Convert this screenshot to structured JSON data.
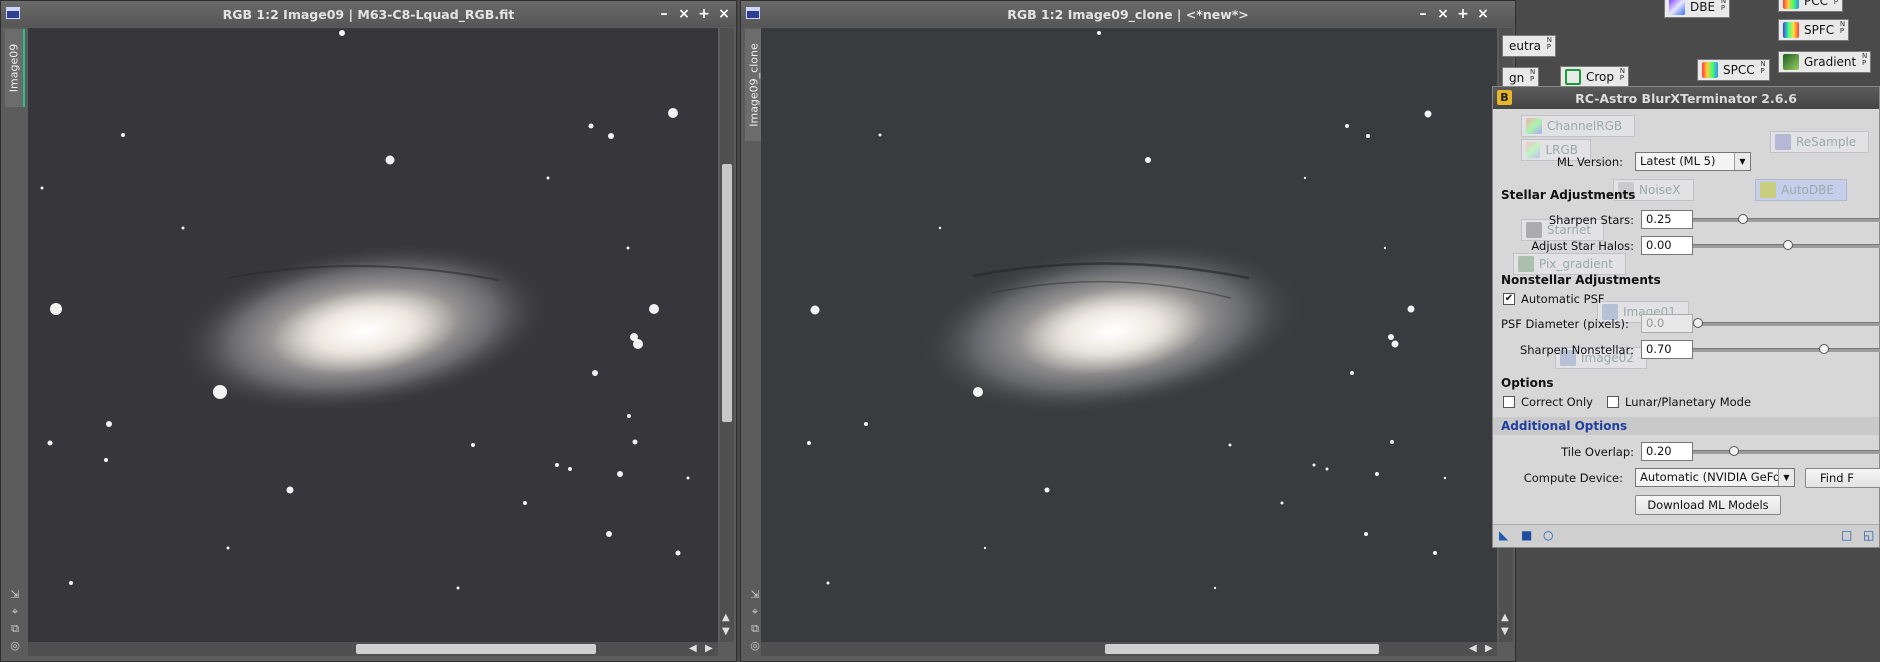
{
  "windows": [
    {
      "title": "RGB 1:2 Image09 | M63-C8-Lquad_RGB.fit",
      "side_tab": "Image09",
      "controls": [
        "–",
        "⨯",
        "+",
        "×"
      ]
    },
    {
      "title": "RGB 1:2 Image09_clone | <*new*>",
      "side_tab": "Image09_clone",
      "controls": [
        "–",
        "⨯",
        "+",
        "×"
      ]
    }
  ],
  "workspace_icons": {
    "dbe": "DBE",
    "pcc": "PCC",
    "spfc": "SPFC",
    "spcc": "SPCC",
    "gradient": "Gradient",
    "neutra": "eutra",
    "lign": "gn",
    "crop": "Crop"
  },
  "dialog": {
    "badge": "B",
    "title": "RC-Astro BlurXTerminator 2.6.6",
    "ghost_icons": {
      "channel_rgb": "ChannelRGB",
      "lrgb": "LRGB",
      "resample": "ReSample",
      "noisex": "NoiseX",
      "autodbe": "AutoDBE",
      "starnet": "Starnet",
      "pix_gradient": "Pix_gradient",
      "image01": "Image01",
      "image02": "Image02"
    },
    "ml_version": {
      "label": "ML Version:",
      "value": "Latest (ML 5)"
    },
    "stellar": {
      "header": "Stellar Adjustments",
      "sharpen_stars": {
        "label": "Sharpen Stars:",
        "value": "0.25",
        "fraction": 0.25
      },
      "adjust_halos": {
        "label": "Adjust Star Halos:",
        "value": "0.00",
        "fraction": 0.5
      }
    },
    "nonstellar": {
      "header": "Nonstellar Adjustments",
      "automatic_psf": {
        "label": "Automatic PSF",
        "checked": true
      },
      "psf_diameter": {
        "label": "PSF Diameter (pixels):",
        "value": "0.0",
        "fraction": 0.0
      },
      "sharpen_nonstellar": {
        "label": "Sharpen Nonstellar:",
        "value": "0.70",
        "fraction": 0.7
      }
    },
    "options": {
      "header": "Options",
      "correct_only": {
        "label": "Correct Only",
        "checked": false
      },
      "lunar_mode": {
        "label": "Lunar/Planetary Mode",
        "checked": false
      }
    },
    "additional": {
      "header": "Additional Options",
      "tile_overlap": {
        "label": "Tile Overlap:",
        "value": "0.20",
        "fraction": 0.2
      },
      "compute_device": {
        "label": "Compute Device:",
        "value": "Automatic (NVIDIA GeForc"
      },
      "find_button": "Find F",
      "download_button": "Download ML Models"
    },
    "footer_icons": [
      "new-instance-icon",
      "apply-global-icon",
      "preview-icon",
      "reset-icon",
      "docs-icon"
    ]
  },
  "colors": {
    "workspace": "#4a4a4a",
    "window_frame": "#5c5c5c",
    "sky": "#37373b",
    "dialog_bg": "#d7d7d7",
    "section_text": "#1f3f9f",
    "tab_accent": "#27c08a"
  }
}
